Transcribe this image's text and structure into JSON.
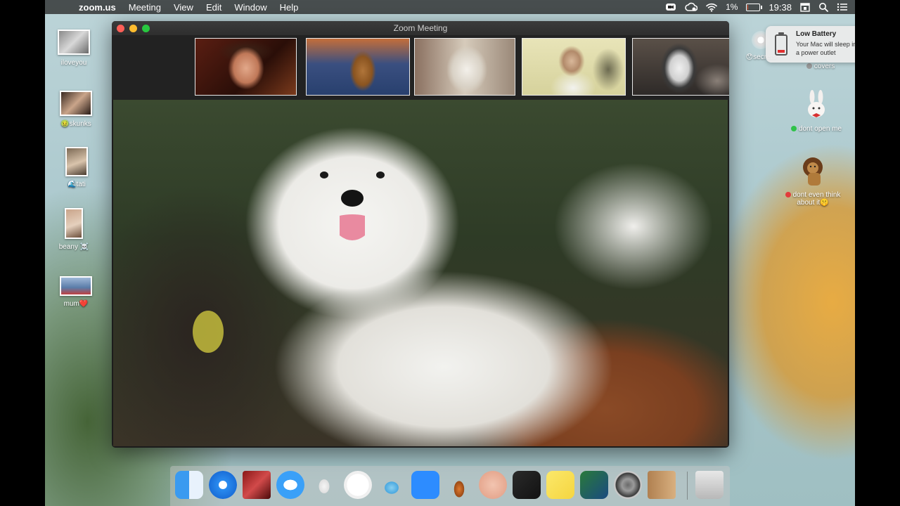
{
  "menubar": {
    "app_name": "zoom.us",
    "menus": [
      "Meeting",
      "View",
      "Edit",
      "Window",
      "Help"
    ],
    "battery_percent": "1%",
    "battery_level": 0.01,
    "clock": "19:38"
  },
  "notification": {
    "title": "Low Battery",
    "body": "Your Mac will sleep into a power outlet"
  },
  "desktop_left": [
    {
      "label": "iloveyou",
      "emoji": ""
    },
    {
      "label": "skunks",
      "emoji": "🤢"
    },
    {
      "label": "tati",
      "emoji": "🌊"
    },
    {
      "label": "beany",
      "emoji": "☠️"
    },
    {
      "label": "mum",
      "emoji": "❤️"
    }
  ],
  "desktop_right": [
    {
      "label": "secrets",
      "emoji": "😯"
    },
    {
      "label": "covers",
      "emoji": ""
    },
    {
      "label": "dont open me",
      "dot_color": "#2fc24a"
    },
    {
      "label": "dont even think about it",
      "emoji": "🤫",
      "dot_color": "#e23b3b"
    }
  ],
  "zoom_window": {
    "title": "Zoom Meeting",
    "participants": [
      {
        "kind": "person-laughing"
      },
      {
        "kind": "dog-brown"
      },
      {
        "kind": "dog-white-terrier"
      },
      {
        "kind": "person-woman"
      },
      {
        "kind": "dog-husky"
      }
    ],
    "speaker": {
      "kind": "dogs-white-maltese"
    }
  },
  "dock": {
    "icons": [
      "finder-icon",
      "safari-icon",
      "photo-booth-icon",
      "messages-icon",
      "cyberduck-icon",
      "music-icon",
      "sequel-pro-icon",
      "zoom-icon",
      "garageband-icon",
      "face-app-icon",
      "voice-memos-icon",
      "stickies-icon",
      "preview-icon",
      "system-preferences-icon",
      "contacts-icon",
      "trash-icon"
    ]
  },
  "colors": {
    "menubar": "#282828",
    "zoom_blue": "#2d8cff",
    "battery_low": "#e03030"
  }
}
